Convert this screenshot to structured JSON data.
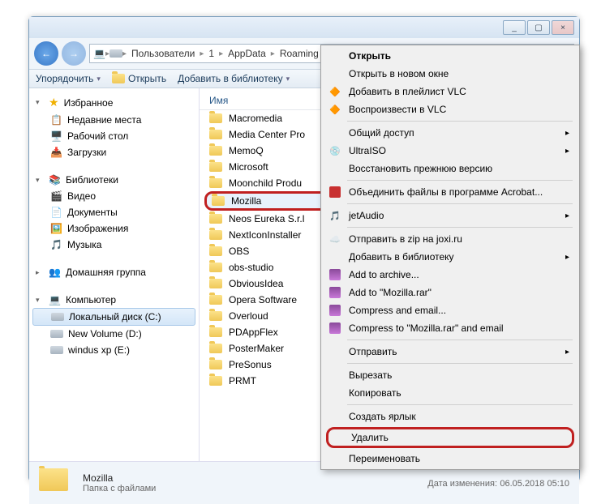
{
  "titlebar": {
    "min": "_",
    "max": "▢",
    "close": "×"
  },
  "breadcrumb": {
    "items": [
      "Пользователи",
      "1",
      "AppData",
      "Roaming"
    ]
  },
  "toolbar": {
    "organize": "Упорядочить",
    "open": "Открыть",
    "library": "Добавить в библиотеку"
  },
  "sidebar": {
    "favorites": {
      "label": "Избранное",
      "items": [
        "Недавние места",
        "Рабочий стол",
        "Загрузки"
      ]
    },
    "libraries": {
      "label": "Библиотеки",
      "items": [
        "Видео",
        "Документы",
        "Изображения",
        "Музыка"
      ]
    },
    "homegroup": {
      "label": "Домашняя группа"
    },
    "computer": {
      "label": "Компьютер",
      "items": [
        "Локальный диск (C:)",
        "New Volume (D:)",
        "windus xp (E:)"
      ],
      "selected_index": 0
    }
  },
  "filelist": {
    "header": "Имя",
    "items": [
      "Macromedia",
      "Media Center Pro",
      "MemoQ",
      "Microsoft",
      "Moonchild Produ",
      "Mozilla",
      "Neos Eureka S.r.l",
      "NextIconInstaller",
      "OBS",
      "obs-studio",
      "ObviousIdea",
      "Opera Software",
      "Overloud",
      "PDAppFlex",
      "PosterMaker",
      "PreSonus",
      "PRMT"
    ],
    "highlighted_index": 5
  },
  "status": {
    "name": "Mozilla",
    "type": "Папка с файлами",
    "date_label": "Дата изменения:",
    "date": "06.05.2018 05:10"
  },
  "context_menu": {
    "items": [
      {
        "label": "Открыть",
        "bold": true
      },
      {
        "label": "Открыть в новом окне"
      },
      {
        "label": "Добавить в плейлист VLC",
        "icon": "vlc"
      },
      {
        "label": "Воспроизвести в VLC",
        "icon": "vlc"
      },
      {
        "sep": true
      },
      {
        "label": "Общий доступ",
        "sub": true
      },
      {
        "label": "UltraISO",
        "sub": true,
        "icon": "drive"
      },
      {
        "label": "Восстановить прежнюю версию"
      },
      {
        "sep": true
      },
      {
        "label": "Объединить файлы в программе Acrobat...",
        "icon": "red"
      },
      {
        "sep": true
      },
      {
        "label": "jetAudio",
        "sub": true,
        "icon": "note"
      },
      {
        "sep": true
      },
      {
        "label": "Отправить в zip на joxi.ru",
        "icon": "cloud"
      },
      {
        "label": "Добавить в библиотеку",
        "sub": true
      },
      {
        "label": "Add to archive...",
        "icon": "rar"
      },
      {
        "label": "Add to \"Mozilla.rar\"",
        "icon": "rar"
      },
      {
        "label": "Compress and email...",
        "icon": "rar"
      },
      {
        "label": "Compress to \"Mozilla.rar\" and email",
        "icon": "rar"
      },
      {
        "sep": true
      },
      {
        "label": "Отправить",
        "sub": true
      },
      {
        "sep": true
      },
      {
        "label": "Вырезать"
      },
      {
        "label": "Копировать"
      },
      {
        "sep": true
      },
      {
        "label": "Создать ярлык"
      },
      {
        "label": "Удалить",
        "highlighted": true
      },
      {
        "label": "Переименовать"
      }
    ]
  }
}
